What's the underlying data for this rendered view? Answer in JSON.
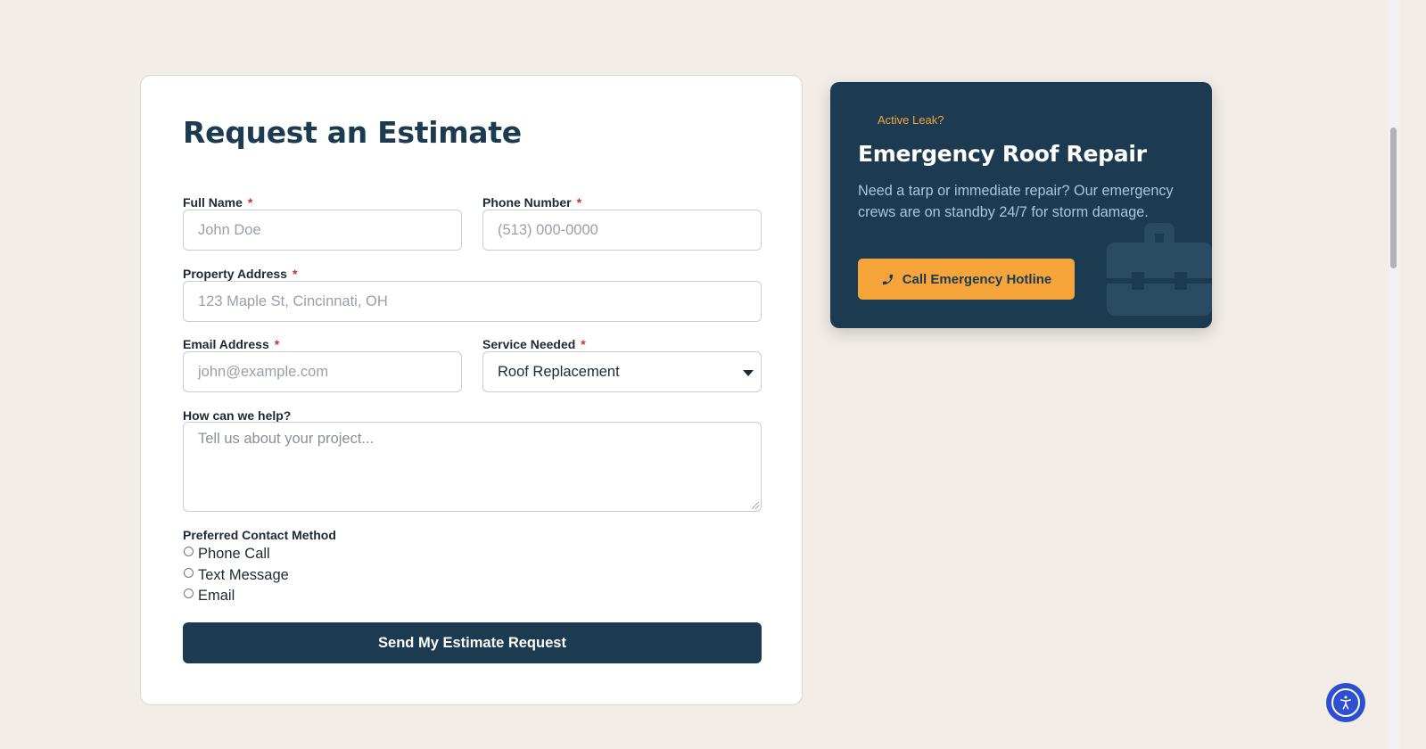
{
  "form": {
    "title": "Request an Estimate",
    "required_mark": "*",
    "full_name": {
      "label": "Full Name",
      "placeholder": "John Doe"
    },
    "phone": {
      "label": "Phone Number",
      "placeholder": "(513) 000-0000"
    },
    "address": {
      "label": "Property Address",
      "placeholder": "123 Maple St, Cincinnati, OH"
    },
    "email": {
      "label": "Email Address",
      "placeholder": "john@example.com"
    },
    "service": {
      "label": "Service Needed",
      "selected": "Roof Replacement"
    },
    "help": {
      "label": "How can we help?",
      "placeholder": "Tell us about your project..."
    },
    "contact_method": {
      "label": "Preferred Contact Method",
      "options": [
        "Phone Call",
        "Text Message",
        "Email"
      ]
    },
    "submit_label": "Send My Estimate Request"
  },
  "emergency": {
    "tag": "Active Leak?",
    "title": "Emergency Roof Repair",
    "description": "Need a tarp or immediate repair? Our emergency crews are on standby 24/7 for storm damage.",
    "button_label": "Call Emergency Hotline",
    "button_icon": "phone-icon",
    "decor_icon": "toolbox-icon"
  },
  "accessibility": {
    "icon": "accessibility-icon"
  },
  "colors": {
    "page_bg": "#f2ede6",
    "navy": "#1c3a50",
    "accent_orange": "#f5a53a",
    "required_red": "#d0302a",
    "accessibility_blue": "#2d4fd0"
  }
}
